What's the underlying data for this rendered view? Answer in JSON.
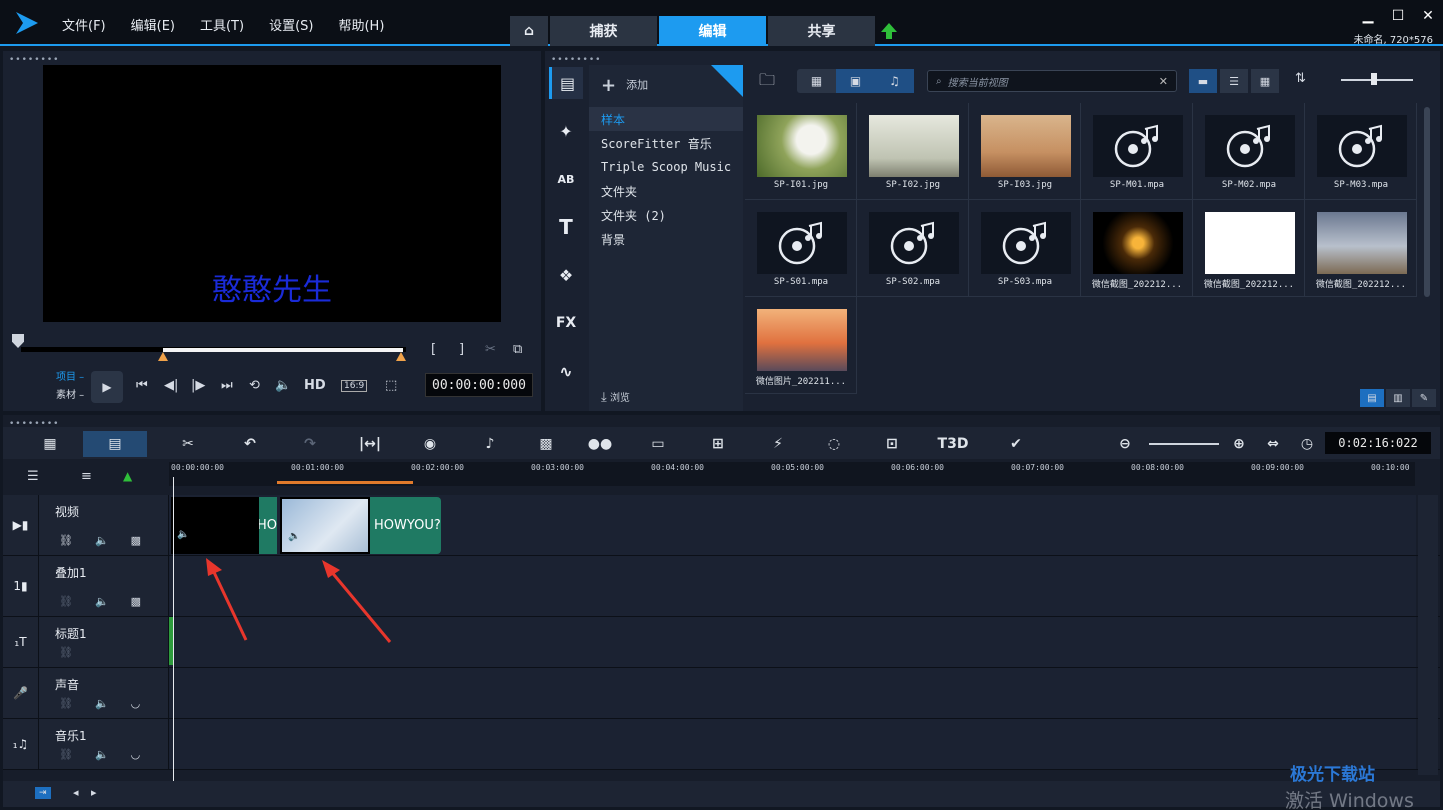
{
  "menu": [
    "文件(F)",
    "编辑(E)",
    "工具(T)",
    "设置(S)",
    "帮助(H)"
  ],
  "tabs": {
    "capture": "捕获",
    "edit": "编辑",
    "share": "共享"
  },
  "project_info": "未命名, 720*576",
  "player": {
    "overlay_text": "憨憨先生",
    "mode_project": "项目",
    "mode_clip": "素材",
    "hd": "HD",
    "aspect": "16:9",
    "timecode": "00:00:00:000"
  },
  "library": {
    "add_label": "添加",
    "folders": [
      "样本",
      "ScoreFitter 音乐",
      "Triple Scoop Music",
      "文件夹",
      "文件夹 (2)",
      "背景"
    ],
    "browse_label": "浏览",
    "search_placeholder": "搜索当前视图",
    "items": [
      {
        "name": "SP-I01.jpg",
        "kind": "image"
      },
      {
        "name": "SP-I02.jpg",
        "kind": "image"
      },
      {
        "name": "SP-I03.jpg",
        "kind": "image"
      },
      {
        "name": "SP-M01.mpa",
        "kind": "audio"
      },
      {
        "name": "SP-M02.mpa",
        "kind": "audio"
      },
      {
        "name": "SP-M03.mpa",
        "kind": "audio"
      },
      {
        "name": "SP-S01.mpa",
        "kind": "audio"
      },
      {
        "name": "SP-S02.mpa",
        "kind": "audio"
      },
      {
        "name": "SP-S03.mpa",
        "kind": "audio"
      },
      {
        "name": "微信截图_202212...",
        "kind": "image"
      },
      {
        "name": "微信截图_202212...",
        "kind": "image"
      },
      {
        "name": "微信截图_202212...",
        "kind": "image"
      },
      {
        "name": "微信图片_202211...",
        "kind": "image"
      }
    ]
  },
  "timeline": {
    "timecode": "0:02:16:022",
    "ruler": [
      "00:00:00:00",
      "00:01:00:00",
      "00:02:00:00",
      "00:03:00:00",
      "00:04:00:00",
      "00:05:00:00",
      "00:06:00:00",
      "00:07:00:00",
      "00:08:00:00",
      "00:09:00:00",
      "00:10:00"
    ],
    "tracks": [
      {
        "name": "视频"
      },
      {
        "name": "叠加1"
      },
      {
        "name": "标题1"
      },
      {
        "name": "声音"
      },
      {
        "name": "音乐1"
      }
    ],
    "clip1_text": "HO",
    "clip2_text": "HOWYOU?"
  },
  "watermark": {
    "activate": "激活 Windows",
    "site": "极光下载站"
  },
  "colors": {
    "accent": "#1d9bf0",
    "clip_green": "#1f7a63",
    "arrow_red": "#e8362c"
  }
}
